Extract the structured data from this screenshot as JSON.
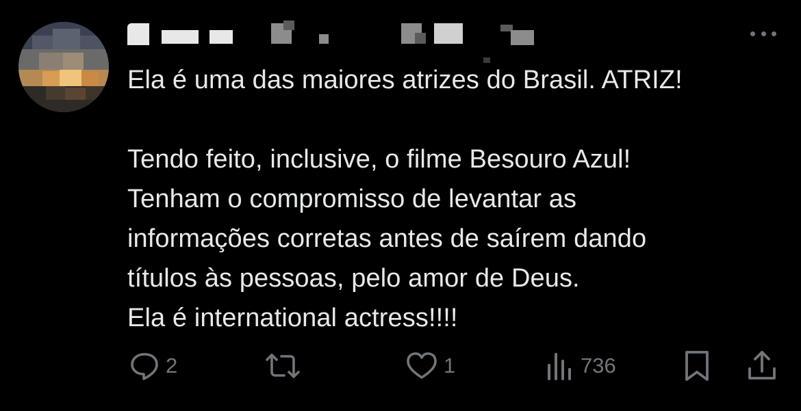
{
  "tweet": {
    "lines": [
      "Ela é uma das maiores atrizes do Brasil. ATRIZ!",
      "",
      "Tendo feito, inclusive, o filme Besouro Azul!",
      "Tenham o compromisso de levantar as",
      "informações corretas antes de saírem dando",
      "títulos às pessoas, pelo amor de Deus.",
      "Ela é international actress!!!!"
    ]
  },
  "actions": {
    "reply_count": "2",
    "retweet_count": "",
    "like_count": "1",
    "views_count": "736"
  },
  "icons": {
    "more": "more-horizontal-icon",
    "reply": "reply-icon",
    "retweet": "retweet-icon",
    "like": "heart-icon",
    "views": "views-icon",
    "bookmark": "bookmark-icon",
    "share": "share-icon"
  },
  "colors": {
    "background": "#000000",
    "text": "#e7e9ea",
    "muted": "#71767b"
  }
}
